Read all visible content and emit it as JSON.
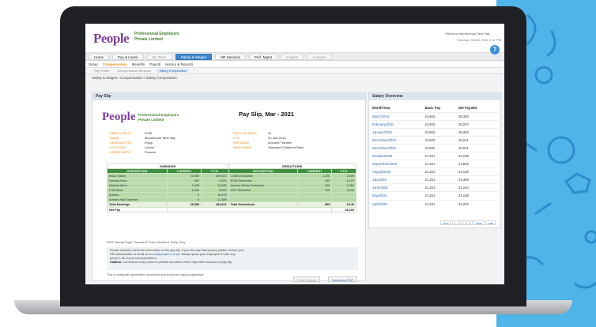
{
  "company": {
    "logo": "People",
    "name_line1": "Professional Employers",
    "name_line2": "Private Limited"
  },
  "header": {
    "user": "Welcome Muhammad Tahir Naz",
    "datetime": "Tuesday, 28 Mar, 2021  2:31 PM",
    "help": "?"
  },
  "main_nav": [
    {
      "label": "Home",
      "state": "normal"
    },
    {
      "label": "Pay & Leave",
      "state": "normal"
    },
    {
      "label": "My Team",
      "state": "dim"
    },
    {
      "label": "Salary & Wages",
      "state": "active"
    },
    {
      "label": "HR Services",
      "state": "normal"
    },
    {
      "label": "Perf. Mgmt",
      "state": "normal"
    },
    {
      "label": "Insights",
      "state": "dim"
    },
    {
      "label": "Analytics",
      "state": "dim"
    }
  ],
  "sub_nav": [
    {
      "label": "Setup",
      "active": false
    },
    {
      "label": "Compensation",
      "active": true
    },
    {
      "label": "Benefits",
      "active": false
    },
    {
      "label": "Payroll",
      "active": false
    },
    {
      "label": "History & Reports",
      "active": false
    }
  ],
  "sub_sub_nav": [
    {
      "label": "Pay Profile",
      "active": false
    },
    {
      "label": "Compensation Structure",
      "active": false
    },
    {
      "label": "Salary Composition",
      "active": true
    }
  ],
  "breadcrumb": "Salary & Wages / Compensation / Salary Composition",
  "payslip": {
    "panel_title": "Pay Slip",
    "title": "Pay Slip, Mar - 2021",
    "info_left": [
      {
        "k": "EMPLOYEE ID",
        "v": "0258"
      },
      {
        "k": "NAME",
        "v": "Muhammad Tahir Naz"
      },
      {
        "k": "DESIGNATION",
        "v": "Enjoy"
      },
      {
        "k": "LOCATION",
        "v": "Lahore"
      },
      {
        "k": "DEPARTMENT",
        "v": "Finance"
      }
    ],
    "info_right": [
      {
        "k": "DAYS WORKED",
        "v": "31"
      },
      {
        "k": "DOJ",
        "v": "20-Jan-2012"
      },
      {
        "k": "PAY MODE",
        "v": "Account Transfer"
      },
      {
        "k": "BANK NAME",
        "v": "Standard Chartered Bank"
      }
    ],
    "earnings_title": "EARNINGS",
    "deductions_title": "DEDUCTIONS",
    "earn_headers": [
      "DESCRIPTION",
      "CURRENT",
      "Y.T.D."
    ],
    "ded_headers": [
      "DESCRIPTION",
      "CURRENT",
      "Y.T.D."
    ],
    "rows": [
      {
        "e": [
          "Basic Salary",
          "16,982",
          "169,820"
        ],
        "d": [
          "LOAN Deduction",
          "2,220",
          "2,500"
        ]
      },
      {
        "e": [
          "Special Allow.",
          "500",
          "4,500"
        ],
        "d": [
          "EOBI Deduction",
          "160",
          "1,120"
        ]
      },
      {
        "e": [
          "Medical Allow.",
          "1,698",
          "15,282"
        ],
        "d": [
          "Income Whole Deduction",
          "400",
          "2,350"
        ]
      },
      {
        "e": [
          "Fuel Allow.",
          "1,000",
          "9,000"
        ],
        "d": [
          "SSC Deduction",
          "315",
          "3,244"
        ]
      },
      {
        "e": [
          "Arrears",
          "0",
          "10,879"
        ],
        "d": [
          "",
          "",
          ""
        ]
      },
      {
        "e": [
          "Arrears Half Expense",
          "0",
          "11,389"
        ],
        "d": [
          "",
          "",
          ""
        ]
      }
    ],
    "total_earnings": [
      "Total Earnings",
      "28,385",
      "284,822"
    ],
    "total_deductions": [
      "Total Deductions",
      "895",
      "9,149"
    ],
    "net_pay": [
      "Net Pay",
      "28,330"
    ],
    "amount_words": "PKR Twenty Eight Thousand Three Hundred Thirty Only",
    "notice_line1": "Please carefully check the information in this pay slip. If you find any discrepancy please contact your",
    "notice_line2_a": "HR Administrator or email us on",
    "notice_email": "pst@people.com.pk",
    "notice_line2_b": ". Always quote your employee ID with any",
    "notice_line3": "query in all of your correspondence.",
    "notice_caution": "Caution:",
    "notice_line4": " Corrections if any must be pointed out within seven days after issuance of pay slip.",
    "computer_note": "This is computer generated document and does not require signature.",
    "email_button": "Email Payslip",
    "download_button": "Download PDF"
  },
  "overview": {
    "panel_title": "Salary Overview",
    "headers": [
      "Month/Year",
      "Basic Pay",
      "Net Payable"
    ],
    "rows": [
      [
        "March/2021",
        "24,802",
        "28,330"
      ],
      [
        "February/2021",
        "24,802",
        "28,247"
      ],
      [
        "January/2021",
        "24,802",
        "28,330"
      ],
      [
        "December/2020",
        "24,802",
        "28,241"
      ],
      [
        "November/2020",
        "24,802",
        "28,021"
      ],
      [
        "October/2020",
        "21,201",
        "24,159"
      ],
      [
        "September/2020",
        "21,201",
        "21,835"
      ],
      [
        "August/2020",
        "21,201",
        "24,159"
      ],
      [
        "July/2020",
        "21,201",
        "43,498"
      ],
      [
        "June/2020",
        "21,201",
        "24,154"
      ],
      [
        "May/2020",
        "21,201",
        "24,159"
      ],
      [
        "April/2020",
        "21,201",
        "24,202"
      ]
    ],
    "pager": [
      "First",
      "1",
      "2",
      "3",
      "Next",
      "Last"
    ]
  },
  "colors": {
    "brand_purple": "#7d3f98",
    "brand_orange": "#e88a12",
    "accent_blue": "#3f86c7",
    "green_header": "#3f8f3f",
    "background_blue": "#4fb4e8"
  }
}
